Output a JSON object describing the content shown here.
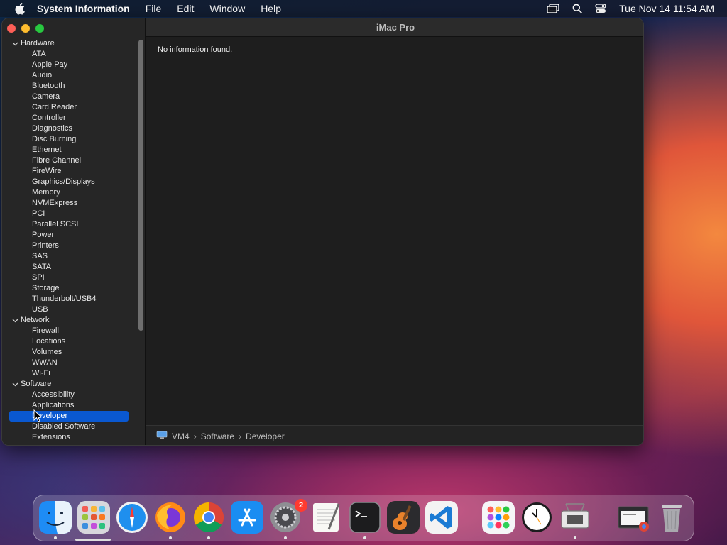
{
  "menubar": {
    "app_name": "System Information",
    "menus": [
      "File",
      "Edit",
      "Window",
      "Help"
    ],
    "clock": "Tue Nov 14  11:54 AM"
  },
  "window": {
    "title": "iMac Pro",
    "message": "No information found."
  },
  "sidebar": {
    "groups": [
      {
        "label": "Hardware",
        "items": [
          "ATA",
          "Apple Pay",
          "Audio",
          "Bluetooth",
          "Camera",
          "Card Reader",
          "Controller",
          "Diagnostics",
          "Disc Burning",
          "Ethernet",
          "Fibre Channel",
          "FireWire",
          "Graphics/Displays",
          "Memory",
          "NVMExpress",
          "PCI",
          "Parallel SCSI",
          "Power",
          "Printers",
          "SAS",
          "SATA",
          "SPI",
          "Storage",
          "Thunderbolt/USB4",
          "USB"
        ]
      },
      {
        "label": "Network",
        "items": [
          "Firewall",
          "Locations",
          "Volumes",
          "WWAN",
          "Wi-Fi"
        ]
      },
      {
        "label": "Software",
        "items": [
          "Accessibility",
          "Applications",
          "Developer",
          "Disabled Software",
          "Extensions"
        ]
      }
    ],
    "selected": "Developer"
  },
  "pathbar": {
    "segments": [
      "VM4",
      "Software",
      "Developer"
    ],
    "separator": "›"
  },
  "dock": {
    "settings_badge": "2"
  },
  "colors": {
    "selection": "#0a58d0",
    "close": "#fe5f57",
    "minimize": "#febc2e",
    "maximize": "#28c840"
  }
}
